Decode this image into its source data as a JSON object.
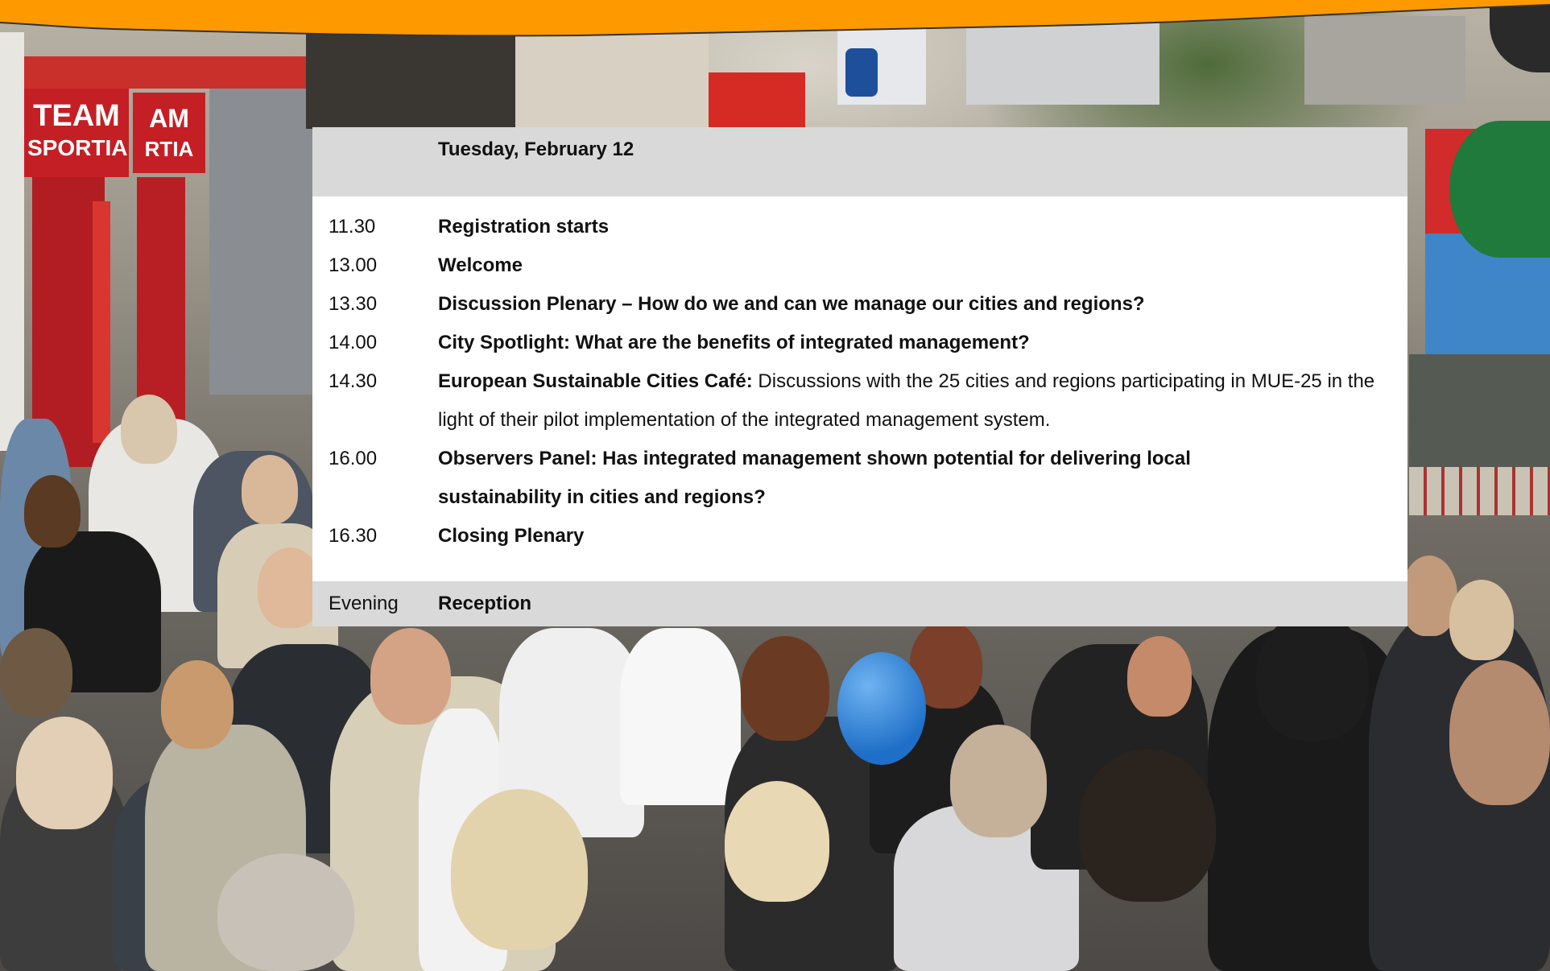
{
  "schedule": {
    "date": "Tuesday, February 12",
    "items": [
      {
        "time": "11.30",
        "title": "Registration starts",
        "desc": ""
      },
      {
        "time": "13.00",
        "title": "Welcome",
        "desc": ""
      },
      {
        "time": "13.30",
        "title": "Discussion Plenary – How do we and can we manage our cities and regions?",
        "desc": ""
      },
      {
        "time": "14.00",
        "title": "City Spotlight: What are the benefits of integrated management?",
        "desc": ""
      },
      {
        "time": "14.30",
        "title": "European Sustainable Cities Café:",
        "desc": " Discussions with the 25 cities and regions participating in MUE-25 in the light of their pilot implementation of the integrated management system."
      },
      {
        "time": "16.00",
        "title": "Observers Panel: Has integrated management shown potential for delivering local sustainability in cities and regions?",
        "desc": ""
      },
      {
        "time": "16.30",
        "title": "Closing Plenary",
        "desc": ""
      }
    ],
    "evening": {
      "time": "Evening",
      "title": "Reception"
    }
  },
  "photo_signs": {
    "sign_1_line1": "TEAM",
    "sign_1_line2": "SPORTIA",
    "sign_2_line1": "AM",
    "sign_2_line2": "RTIA"
  },
  "colors": {
    "banner": "#ff9900",
    "panel_header": "#d9d9d9",
    "panel_body": "#ffffff"
  }
}
